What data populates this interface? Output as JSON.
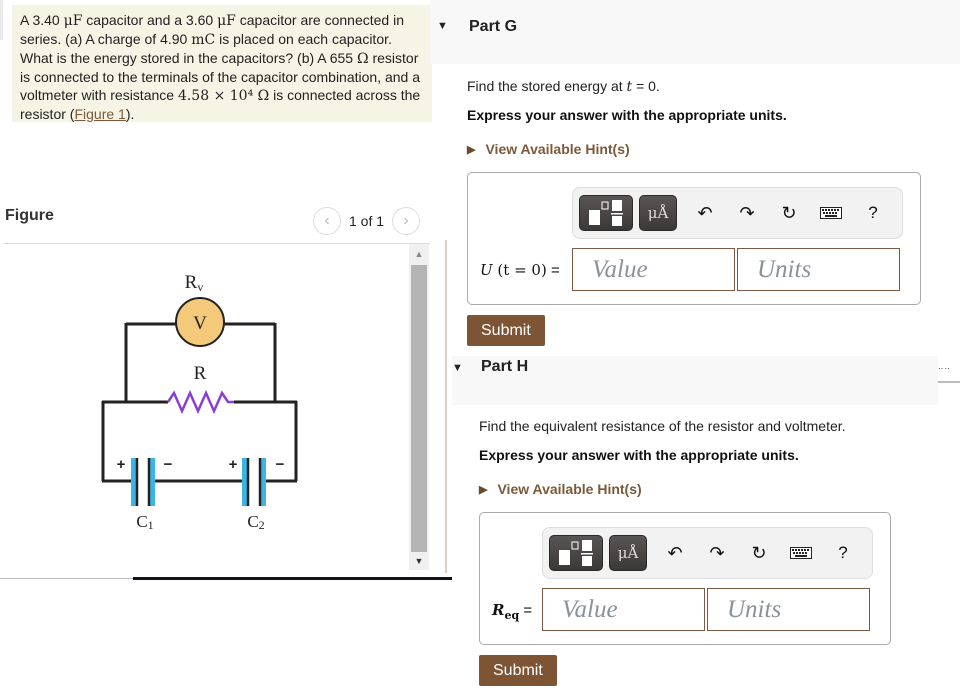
{
  "problem": {
    "segments": [
      {
        "t": "A 3.40 "
      },
      {
        "m": "μF"
      },
      {
        "t": " capacitor and a 3.60 "
      },
      {
        "m": "μF"
      },
      {
        "t": " capacitor are connected in series. (a) A charge of 4.90 "
      },
      {
        "m": "mC"
      },
      {
        "t": " is placed on each capacitor. What is the energy stored in the capacitors? (b) A 655 "
      },
      {
        "m": "Ω"
      },
      {
        "t": " resistor is connected to the terminals of the capacitor combination, and a voltmeter with resistance "
      },
      {
        "m": "4.58 × 10⁴ Ω"
      },
      {
        "t": " is connected across the resistor ("
      },
      {
        "link": "Figure 1"
      },
      {
        "t": ")."
      }
    ]
  },
  "figure": {
    "title": "Figure",
    "page_indicator": "1 of 1",
    "prev_icon": "chevron-left-icon",
    "next_icon": "chevron-right-icon",
    "circuit": {
      "voltmeter_label": "Rv",
      "voltmeter_symbol": "V",
      "resistor_label": "R",
      "capacitor1_label": "C1",
      "capacitor2_label": "C2",
      "plus": "+",
      "minus": "−",
      "colors": {
        "wire": "#222222",
        "voltmeter_fill": "#f5c97a",
        "resistor": "#8a3fd6",
        "capacitor_plate": "#3cb4e6"
      }
    }
  },
  "parts": [
    {
      "title": "Part G",
      "instruction_pre": "Find the stored energy at ",
      "instruction_var": "t",
      "instruction_post": " = 0.",
      "express": "Express your answer with the appropriate units.",
      "hint": "View Available Hint(s)",
      "answer_label_var": "U",
      "answer_label_rest": " (t = 0)",
      "answer_label_eq": " =",
      "value_placeholder": "Value",
      "units_placeholder": "Units",
      "submit": "Submit"
    },
    {
      "title": "Part H",
      "instruction_pre": "Find the equivalent resistance of the resistor and voltmeter.",
      "instruction_var": "",
      "instruction_post": "",
      "express": "Express your answer with the appropriate units.",
      "hint": "View Available Hint(s)",
      "answer_label_var": "R",
      "answer_label_sub": "eq",
      "answer_label_eq": " =",
      "value_placeholder": "Value",
      "units_placeholder": "Units",
      "submit": "Submit"
    }
  ],
  "toolbar": {
    "units_label": "μÅ",
    "undo": "↶",
    "redo": "↷",
    "reset": "↻",
    "help": "?"
  },
  "colors": {
    "accent_brown": "#7d5535",
    "hint_brown": "#7a5a3a",
    "problem_bg": "#f6f4e4"
  }
}
